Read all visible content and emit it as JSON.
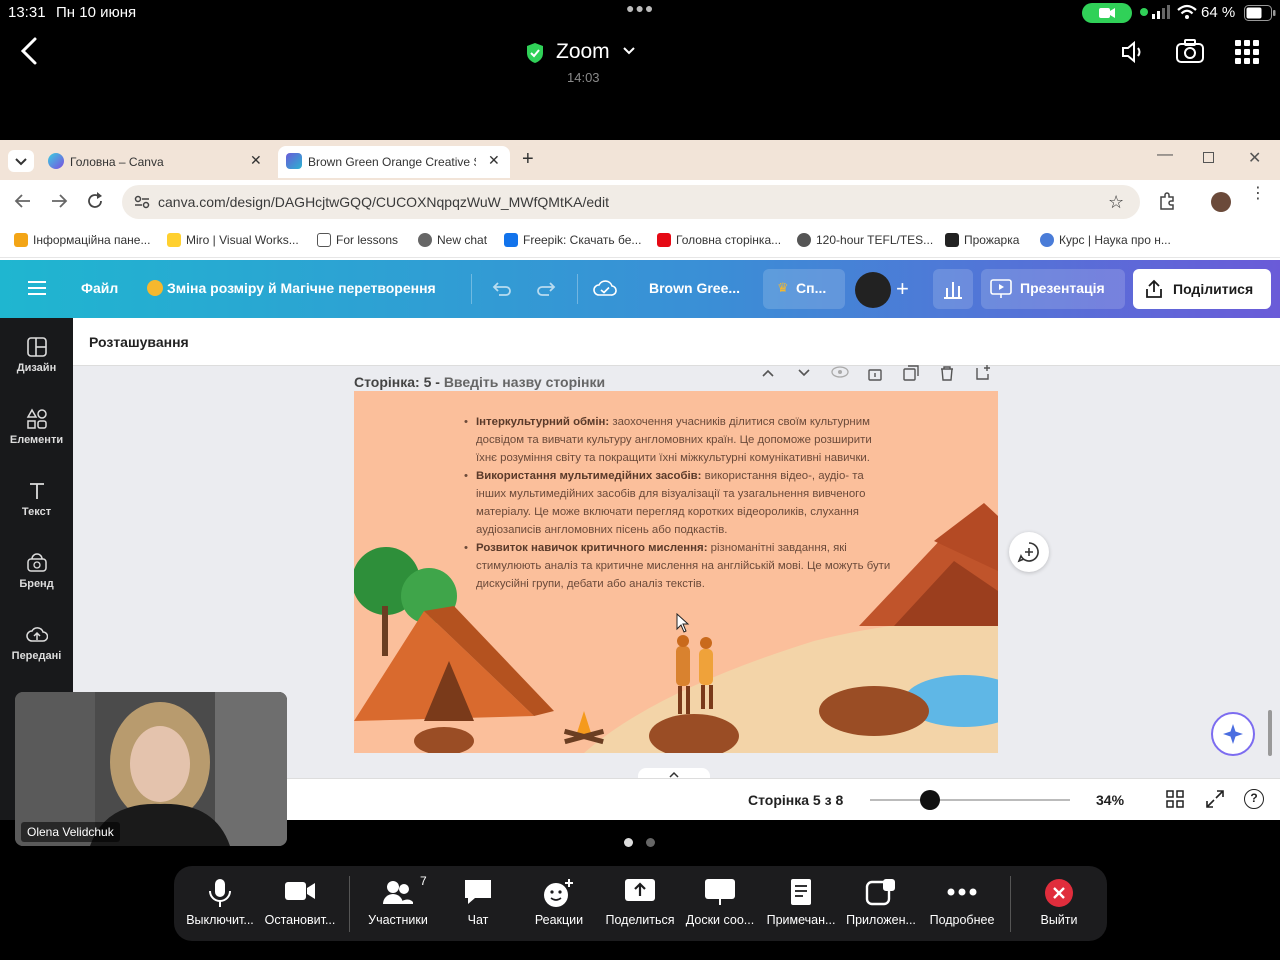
{
  "status_bar": {
    "time": "13:31",
    "date": "Пн 10 июня",
    "battery": "64 %"
  },
  "zoom_header": {
    "title": "Zoom",
    "timer": "14:03",
    "icons": [
      "back-icon",
      "shield-check-icon",
      "chevron-down-icon",
      "speaker-icon",
      "camera-switch-icon",
      "grid-icon"
    ]
  },
  "browser": {
    "tabs": [
      {
        "label": "Головна – Canva",
        "active": false
      },
      {
        "label": "Brown Green Orange Creative S",
        "active": true
      }
    ],
    "url": "canva.com/design/DAGHcjtwGQQ/CUCOXNqpqzWuW_MWfQMtKA/edit",
    "bookmarks": [
      "Інформаційна пане...",
      "Miro | Visual Works...",
      "For lessons",
      "New chat",
      "Freepik: Скачать бе...",
      "Головна сторінка...",
      "120-hour TEFL/TES...",
      "Прожарка",
      "Курс | Наука про н..."
    ]
  },
  "canva": {
    "topbar": {
      "file": "Файл",
      "resize": "Зміна розміру й Магічне перетворення",
      "doc_title": "Brown Gree...",
      "share_pill": "Сп...",
      "present": "Презентація",
      "share": "Поділитися"
    },
    "sidebar": [
      {
        "label": "Дизайн",
        "icon": "design-icon"
      },
      {
        "label": "Елементи",
        "icon": "elements-icon"
      },
      {
        "label": "Текст",
        "icon": "text-icon"
      },
      {
        "label": "Бренд",
        "icon": "brand-icon"
      },
      {
        "label": "Передані",
        "icon": "uploads-icon"
      }
    ],
    "position_header": "Розташування",
    "page_header": {
      "label": "Сторінка: 5 -",
      "placeholder": "Введіть назву сторінки"
    },
    "slide": {
      "bullets": [
        {
          "bold": "Інтеркультурний обмін:",
          "text": " заохочення учасників ділитися своїм культурним досвідом та вивчати культуру англомовних країн. Це допоможе розширити їхнє розуміння світу та покращити їхні міжкультурні комунікативні навички."
        },
        {
          "bold": "Використання мультимедійних засобів:",
          "text": " використання відео-, аудіо- та інших мультимедійних засобів для візуалізації та узагальнення вивченого матеріалу. Це може включати перегляд коротких відеороликів, слухання аудіозаписів англомовних пісень або подкастів."
        },
        {
          "bold": "Розвиток навичок критичного мислення:",
          "text": " різноманітні завдання, які стимулюють аналіз та критичне мислення на англійській мові. Це можуть бути дискусійні групи, дебати або аналіз текстів."
        }
      ]
    },
    "footer": {
      "page_indicator": "Сторінка 5 з 8",
      "zoom": "34%",
      "zoom_level": 0.3
    }
  },
  "video": {
    "name": "Olena Velidchuk"
  },
  "toolbar": {
    "items": [
      {
        "label": "Выключит...",
        "icon": "microphone-icon"
      },
      {
        "label": "Остановит...",
        "icon": "video-camera-icon"
      },
      {
        "label": "Участники",
        "icon": "participants-icon",
        "badge": "7"
      },
      {
        "label": "Чат",
        "icon": "chat-icon"
      },
      {
        "label": "Реакции",
        "icon": "reaction-icon"
      },
      {
        "label": "Поделиться",
        "icon": "share-screen-icon"
      },
      {
        "label": "Доски соо...",
        "icon": "whiteboard-icon"
      },
      {
        "label": "Примечан...",
        "icon": "notes-icon"
      },
      {
        "label": "Приложен...",
        "icon": "apps-icon"
      },
      {
        "label": "Подробнее",
        "icon": "more-icon"
      },
      {
        "label": "Выйти",
        "icon": "leave-icon"
      }
    ]
  },
  "colors": {
    "accent_green": "#30d158",
    "leave_red": "#e02d3c",
    "slide_bg": "#fbbf9b"
  }
}
